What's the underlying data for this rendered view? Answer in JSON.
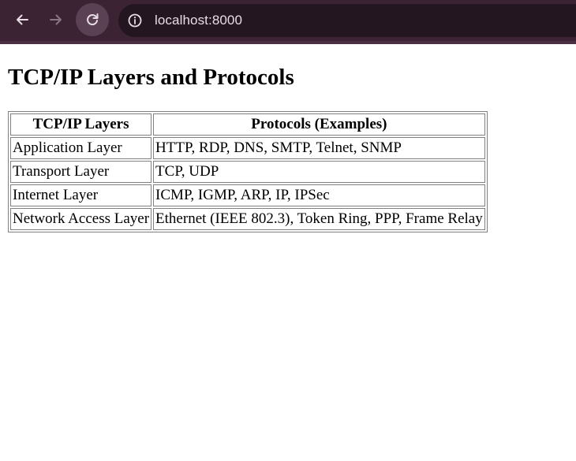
{
  "browser": {
    "url": "localhost:8000",
    "colors": {
      "toolbar_bg": "#3b2334",
      "address_bar_bg": "#241620",
      "icon_color": "#e8dde5",
      "disabled_icon_color": "#8a7584"
    },
    "icons": {
      "back": "arrow-left-icon",
      "forward": "arrow-right-icon",
      "reload": "reload-icon",
      "site_info": "info-icon"
    }
  },
  "page": {
    "title": "TCP/IP Layers and Protocols",
    "table": {
      "headers": [
        "TCP/IP Layers",
        "Protocols (Examples)"
      ],
      "rows": [
        {
          "layer": "Application Layer",
          "protocols": "HTTP, RDP, DNS, SMTP, Telnet, SNMP"
        },
        {
          "layer": "Transport Layer",
          "protocols": "TCP, UDP"
        },
        {
          "layer": "Internet Layer",
          "protocols": "ICMP, IGMP, ARP, IP, IPSec"
        },
        {
          "layer": "Network Access Layer",
          "protocols": "Ethernet (IEEE 802.3), Token Ring, PPP, Frame Relay"
        }
      ]
    }
  }
}
